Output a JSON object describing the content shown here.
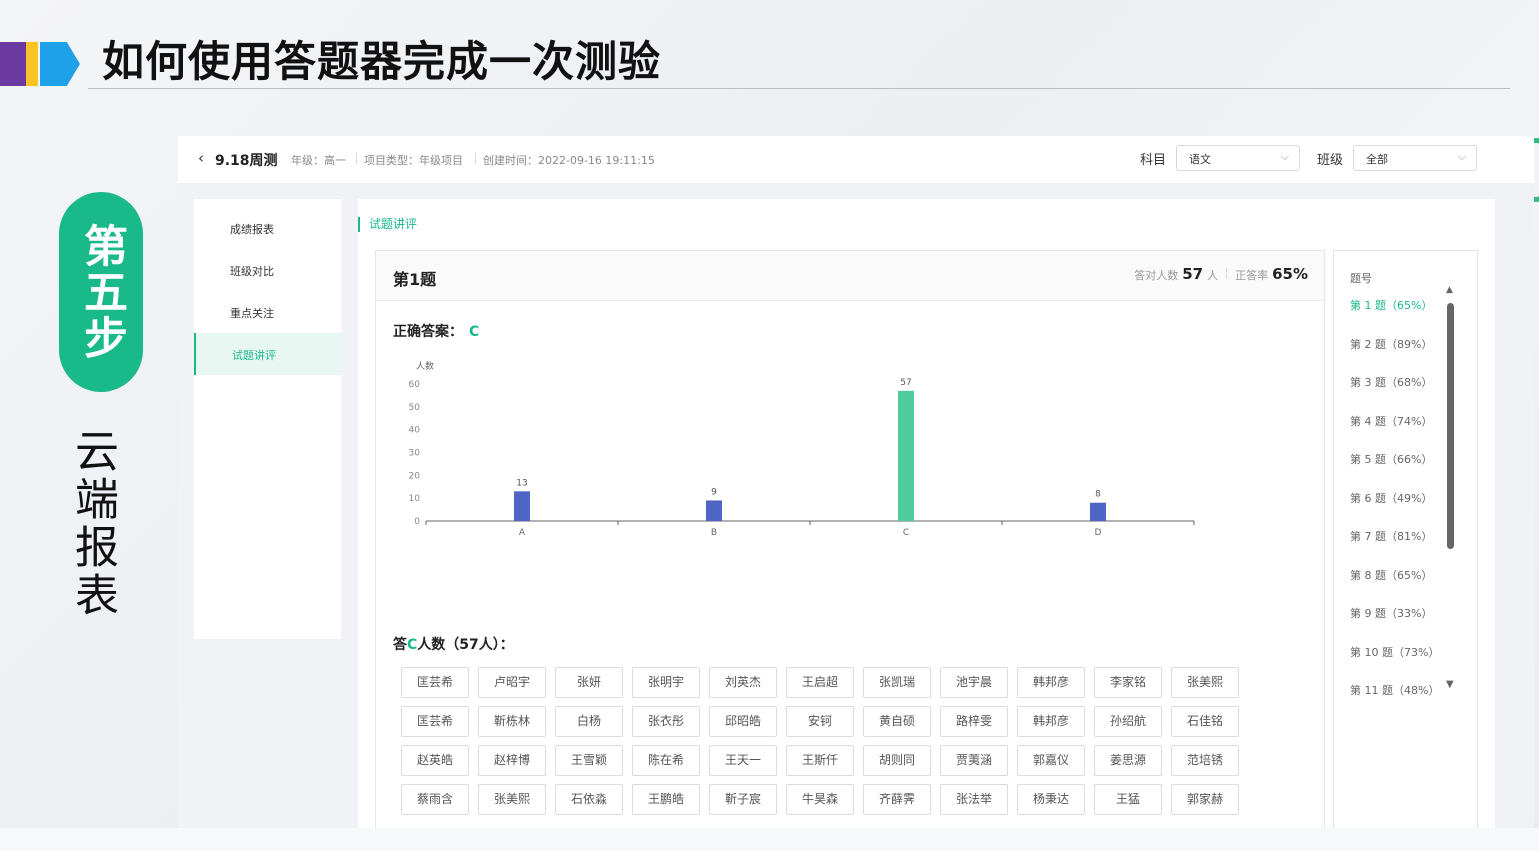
{
  "slide": {
    "title": "如何使用答题器完成一次测验",
    "step_label": "第五步",
    "step_sub": "云端报表"
  },
  "colors": {
    "accent": "#19b98a",
    "bar_blue": "#4e65c6",
    "bar_green": "#4fcb9c"
  },
  "topbar": {
    "back_icon": "chevron-left-icon",
    "exam_name": "9.18周测",
    "grade": "年级：高一",
    "project_type": "项目类型：年级项目",
    "created": "创建时间：2022-09-16 19:11:15",
    "subject_label": "科目",
    "subject_value": "语文",
    "class_label": "班级",
    "class_value": "全部"
  },
  "sidebar": {
    "items": [
      {
        "label": "成绩报表"
      },
      {
        "label": "班级对比"
      },
      {
        "label": "重点关注"
      },
      {
        "label": "试题讲评"
      }
    ],
    "active_index": 3
  },
  "main": {
    "section_title": "试题讲评",
    "question": {
      "number": "第1题",
      "correct_count_label": "答对人数",
      "correct_count": "57",
      "count_unit": "人",
      "rate_label": "正答率",
      "rate": "65%",
      "answer_label": "正确答案：",
      "answer": "C"
    },
    "who_prefix": "答",
    "who_option": "C",
    "who_suffix": "人数（57人）：",
    "names": [
      "匡芸希",
      "卢昭宇",
      "张妍",
      "张明宇",
      "刘英杰",
      "王启超",
      "张凯瑞",
      "池宇晨",
      "韩邦彦",
      "李家铭",
      "张美熙",
      "匡芸希",
      "靳栋林",
      "白杨",
      "张衣彤",
      "邱昭皓",
      "安钶",
      "黄自硕",
      "路梓雯",
      "韩邦彦",
      "孙绍航",
      "石佳铭",
      "赵英皓",
      "赵梓博",
      "王雪颖",
      "陈在希",
      "王天一",
      "王斯仟",
      "胡则同",
      "贾荑涵",
      "郭嘉仪",
      "姜思源",
      "范培锈",
      "蔡雨含",
      "张美熙",
      "石依淼",
      "王鹏皓",
      "靳子宸",
      "牛昊森",
      "齐薛霁",
      "张法举",
      "杨秉达",
      "王猛",
      "郭家赫"
    ]
  },
  "question_list": {
    "header": "题号",
    "items": [
      "第 1 题（65%）",
      "第 2 题（89%）",
      "第 3 题（68%）",
      "第 4 题（74%）",
      "第 5 题（66%）",
      "第 6 题（49%）",
      "第 7 题（81%）",
      "第 8 题（65%）",
      "第 9 题（33%）",
      "第 10 题（73%）",
      "第 11 题（48%）"
    ],
    "active_index": 0
  },
  "chart_data": {
    "type": "bar",
    "ylabel": "人数",
    "categories": [
      "A",
      "B",
      "C",
      "D"
    ],
    "values": [
      13,
      9,
      57,
      8
    ],
    "ylim": [
      0,
      60
    ],
    "yticks": [
      0,
      10,
      20,
      30,
      40,
      50,
      60
    ],
    "highlight": "C",
    "data_labels": true,
    "grid": false
  }
}
